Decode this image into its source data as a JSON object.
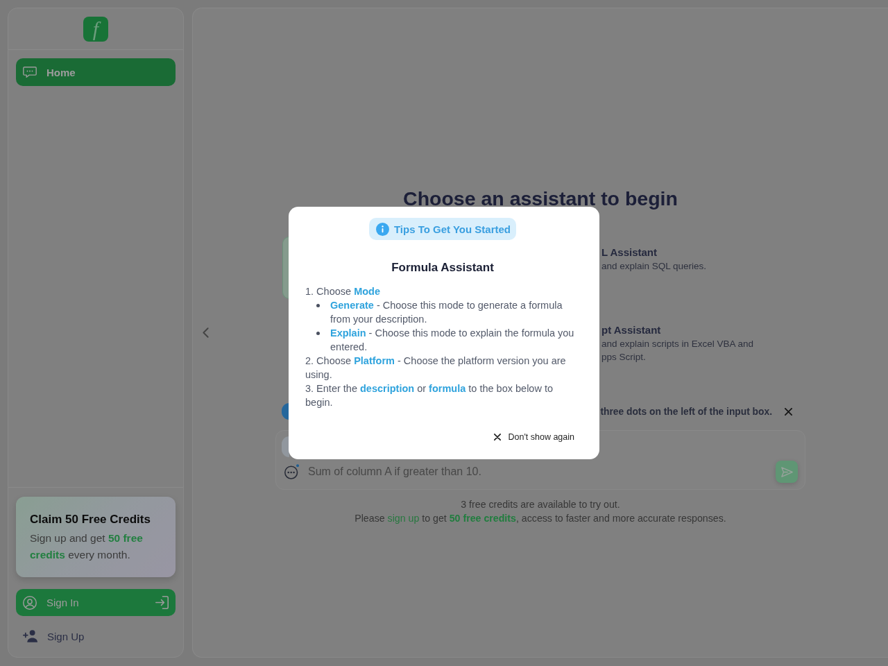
{
  "sidebar": {
    "logo": "f",
    "nav": [
      {
        "label": "Home",
        "selected": true
      }
    ],
    "promo": {
      "title": "Claim 50 Free Credits",
      "text": "Sign up and get **50 free credits** every month."
    },
    "sign_in": "Sign In",
    "sign_up": "Sign Up"
  },
  "main": {
    "heading": "Choose an assistant to begin",
    "assistant_cards": {
      "left": [
        {
          "selected": true
        }
      ],
      "right": [
        {
          "title": "L Assistant",
          "description": [
            "and explain SQL queries."
          ]
        },
        {
          "title": "pt Assistant",
          "description": [
            "and explain scripts in Excel VBA and",
            "pps Script."
          ]
        }
      ]
    },
    "tip_bar": {
      "text": "three dots on the left of the input box."
    },
    "composer": {
      "placeholder": "Sum of column A if greater than 10.",
      "send_disabled": true
    },
    "credits": {
      "note": "3 free credits are available to try out.",
      "prompt_before": "Please",
      "link": "sign up",
      "prompt_after": "to get **50 free credits**, access to faster and more accurate responses."
    }
  },
  "tips_dialog": {
    "badge": "Tips To Get You Started",
    "title": "Formula Assistant",
    "steps": [
      {
        "text": "1. Choose **Mode**",
        "children": [
          {
            "text": "**Generate** - Choose this mode to generate a formula from your description."
          },
          {
            "text": "**Explain** - Choose this mode to explain the formula you entered."
          }
        ]
      },
      {
        "text": "2. Choose **Platform** - Choose the platform version you are using."
      },
      {
        "text": "3. Enter the **description** or **formula** to the box below to begin."
      }
    ],
    "dismiss": "Don't show again"
  }
}
